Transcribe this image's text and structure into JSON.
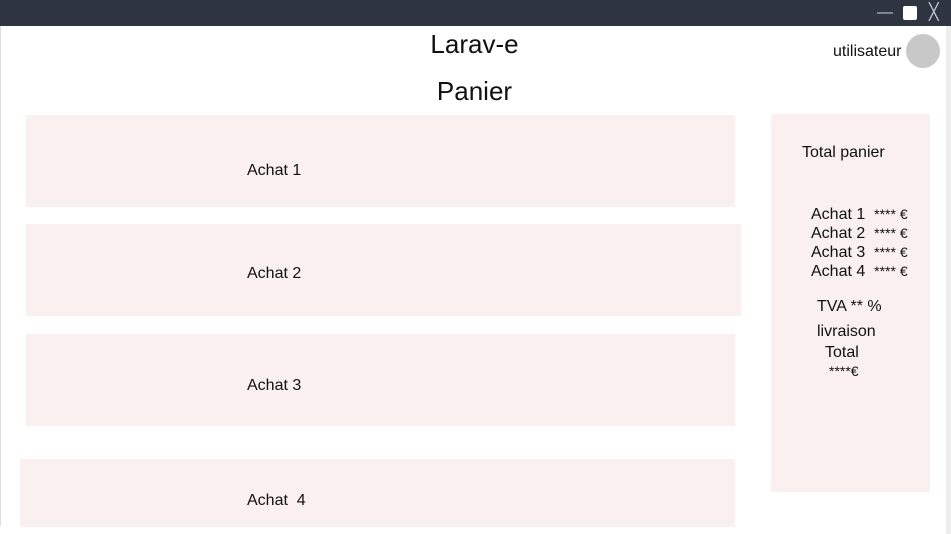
{
  "window": {
    "minimize": "—",
    "close": "╳"
  },
  "header": {
    "app_title": "Larav-e",
    "page_title": "Panier",
    "user": "utilisateur"
  },
  "items": [
    {
      "label": "Achat 1"
    },
    {
      "label": "Achat 2"
    },
    {
      "label": "Achat 3"
    },
    {
      "label": "Achat  4"
    }
  ],
  "summary": {
    "title": "Total panier",
    "lines": [
      {
        "label": "Achat 1",
        "price": "**** €"
      },
      {
        "label": "Achat 2",
        "price": "**** €"
      },
      {
        "label": "Achat 3",
        "price": "**** €"
      },
      {
        "label": "Achat 4",
        "price": "**** €"
      }
    ],
    "tva": "TVA ** %",
    "livraison": "livraison",
    "total_label": "Total",
    "total_value": "****€"
  }
}
